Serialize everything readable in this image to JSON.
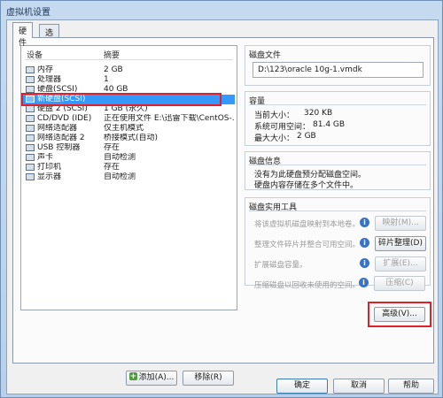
{
  "window": {
    "title": "虚拟机设置"
  },
  "tabs": [
    {
      "label": "硬件"
    },
    {
      "label": "选项"
    }
  ],
  "device_list": {
    "col_device": "设备",
    "col_summary": "摘要",
    "items": [
      {
        "name": "内存",
        "summary": "2 GB",
        "icon": "memory-icon"
      },
      {
        "name": "处理器",
        "summary": "1",
        "icon": "processor-icon"
      },
      {
        "name": "硬盘(SCSI)",
        "summary": "40 GB",
        "icon": "hard-disk-icon"
      },
      {
        "name": "新硬盘(SCSI)",
        "summary": "",
        "icon": "hard-disk-icon",
        "selected": true
      },
      {
        "name": "硬盘 2 (SCSI)",
        "summary": "1 GB (永久)",
        "icon": "hard-disk-icon"
      },
      {
        "name": "CD/DVD (IDE)",
        "summary": "正在使用文件 E:\\迅雷下载\\CentOS-...",
        "icon": "cd-dvd-icon"
      },
      {
        "name": "网络适配器",
        "summary": "仅主机模式",
        "icon": "network-adapter-icon"
      },
      {
        "name": "网络适配器 2",
        "summary": "桥接模式(自动)",
        "icon": "network-adapter-icon"
      },
      {
        "name": "USB 控制器",
        "summary": "存在",
        "icon": "usb-icon"
      },
      {
        "name": "声卡",
        "summary": "自动检测",
        "icon": "sound-card-icon"
      },
      {
        "name": "打印机",
        "summary": "存在",
        "icon": "printer-icon"
      },
      {
        "name": "显示器",
        "summary": "自动检测",
        "icon": "display-icon"
      }
    ],
    "add_button": "添加(A)...",
    "remove_button": "移除(R)"
  },
  "disk_file": {
    "title": "磁盘文件",
    "path": "D:\\123\\oracle 10g-1.vmdk"
  },
  "capacity": {
    "title": "容量",
    "current_label": "当前大小：",
    "current_value": "320 KB",
    "free_label": "系统可用空间：",
    "free_value": "81.4 GB",
    "max_label": "最大大小：",
    "max_value": "2 GB"
  },
  "disk_info": {
    "title": "磁盘信息",
    "line1": "没有为此硬盘预分配磁盘空间。",
    "line2": "硬盘内容存储在多个文件中。"
  },
  "utilities": {
    "title": "磁盘实用工具",
    "map_label": "将该虚拟机磁盘映射到本地卷。",
    "map_button": "映射(M)...",
    "defrag_label": "整理文件碎片并整合可用空间。",
    "defrag_button": "碎片整理(D)",
    "expand_label": "扩展磁盘容量。",
    "expand_button": "扩展(E)...",
    "compact_label": "压缩磁盘以回收未使用的空间。",
    "compact_button": "压缩(C)",
    "advanced_button": "高级(V)...",
    "info_glyph": "i"
  },
  "footer": {
    "ok": "确定",
    "cancel": "取消",
    "help": "帮助"
  },
  "colors": {
    "selection": "#3399ff",
    "highlight_box": "#e0202a"
  }
}
